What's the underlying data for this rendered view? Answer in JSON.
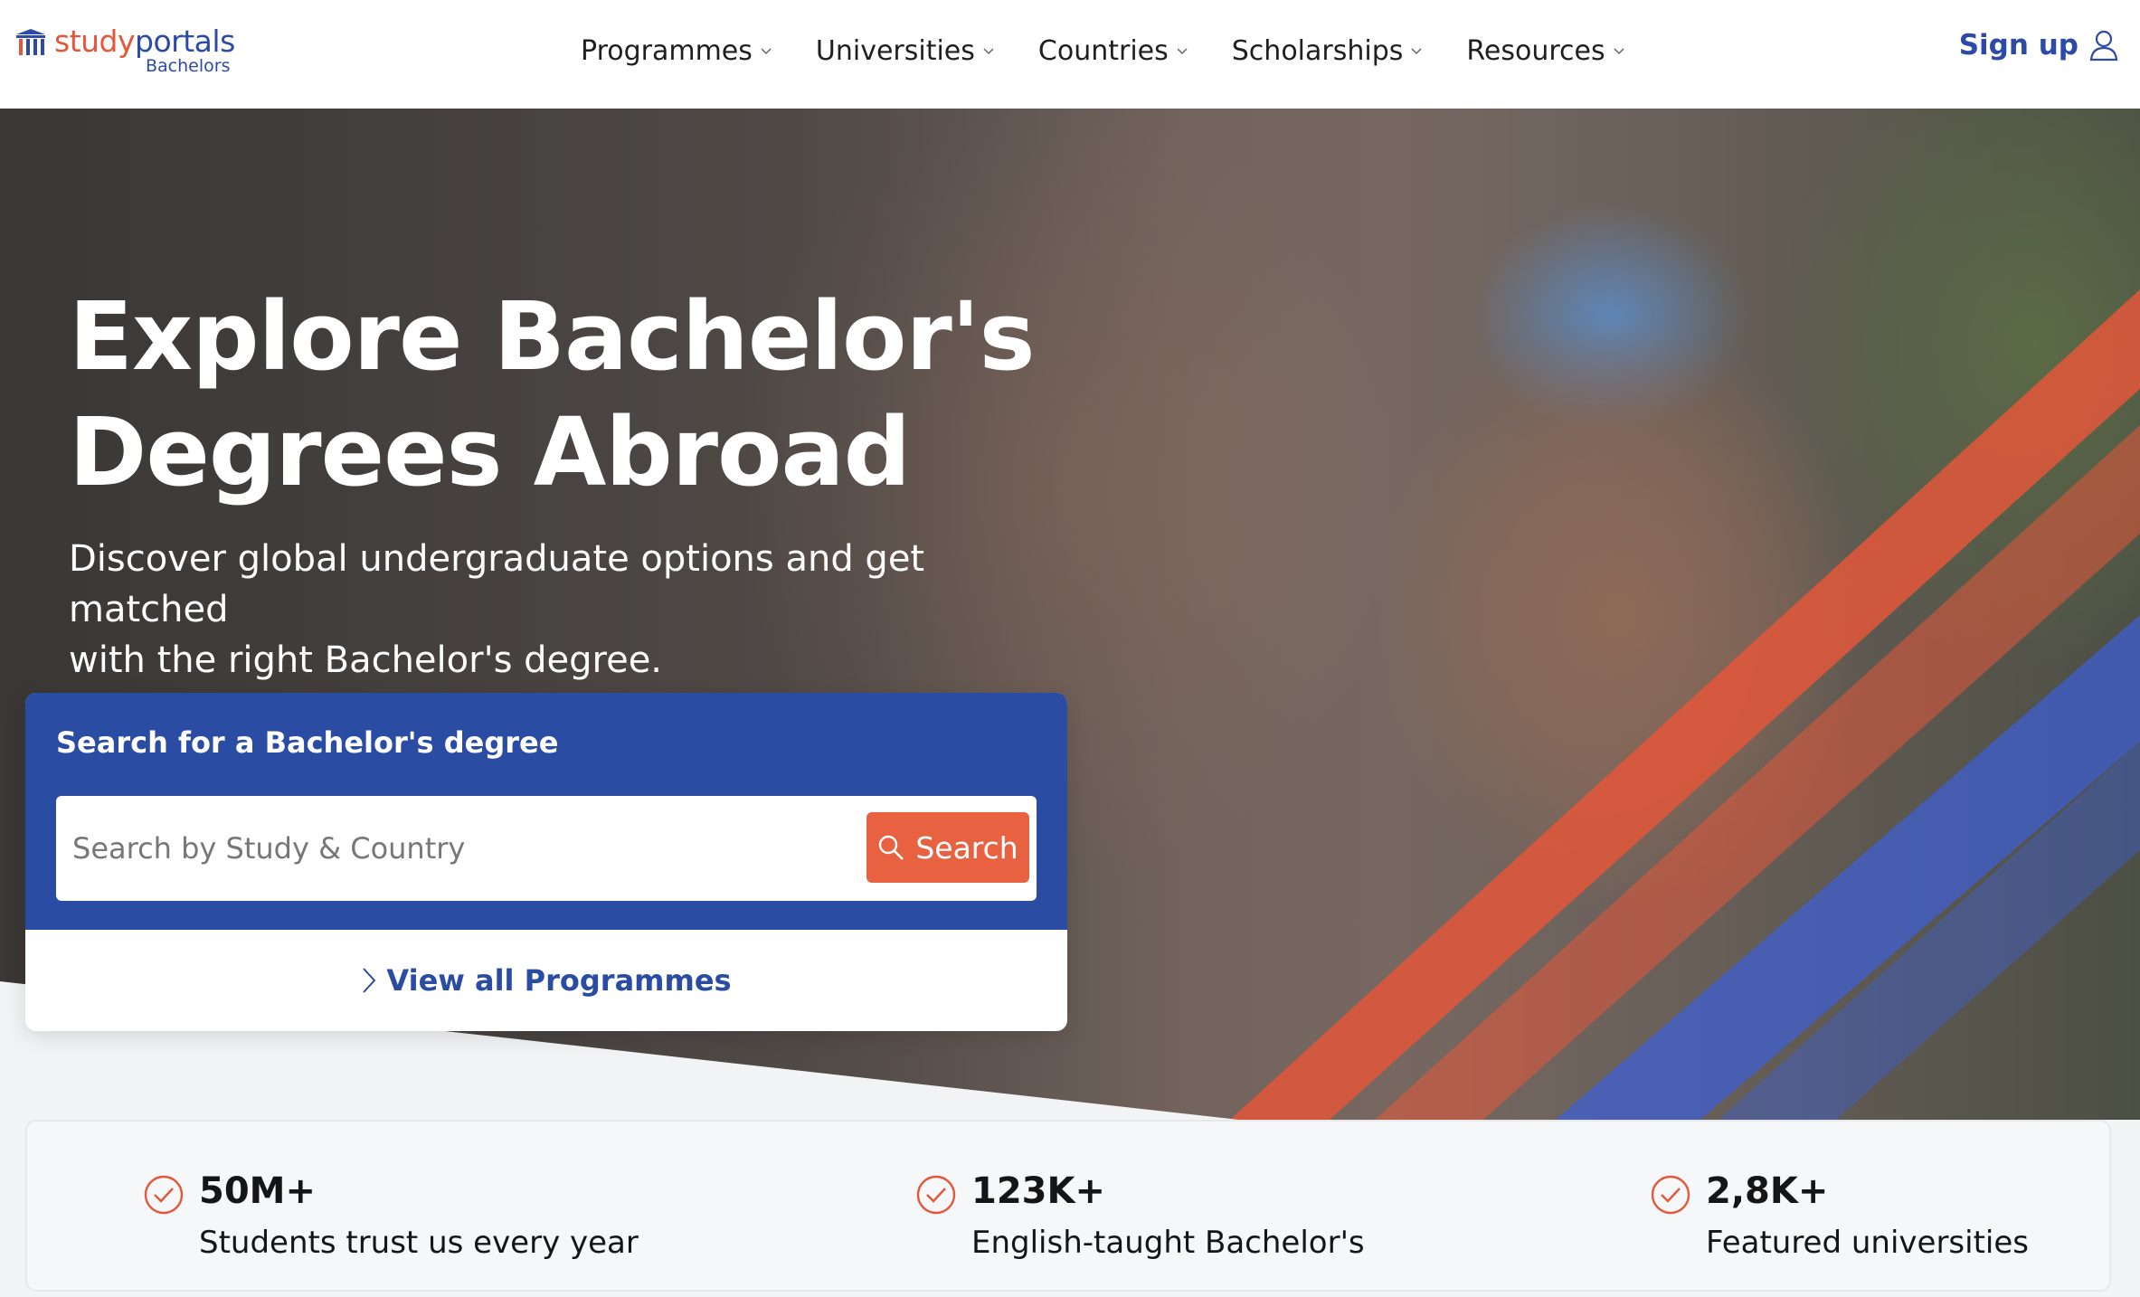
{
  "brand": {
    "name_part1": "study",
    "name_part2": "portals",
    "subtitle": "Bachelors",
    "accent_orange": "#e3573a",
    "accent_blue": "#2c4aa6"
  },
  "nav": {
    "items": [
      {
        "label": "Programmes"
      },
      {
        "label": "Universities"
      },
      {
        "label": "Countries"
      },
      {
        "label": "Scholarships"
      },
      {
        "label": "Resources"
      }
    ],
    "signup_label": "Sign up"
  },
  "hero": {
    "title_line1": "Explore Bachelor's",
    "title_line2": "Degrees Abroad",
    "subtitle_line1": "Discover global undergraduate options and get matched",
    "subtitle_line2": "with the right Bachelor's degree."
  },
  "search": {
    "heading": "Search for a Bachelor's degree",
    "placeholder": "Search by Study & Country",
    "button_label": "Search",
    "view_all_label": "View all Programmes"
  },
  "stats": [
    {
      "value": "50M+",
      "label": "Students trust us every year",
      "icon": "check-circle-icon"
    },
    {
      "value": "123K+",
      "label": "English-taught Bachelor's",
      "icon": "check-circle-icon"
    },
    {
      "value": "2,8K+",
      "label": "Featured universities",
      "icon": "check-circle-icon"
    }
  ]
}
